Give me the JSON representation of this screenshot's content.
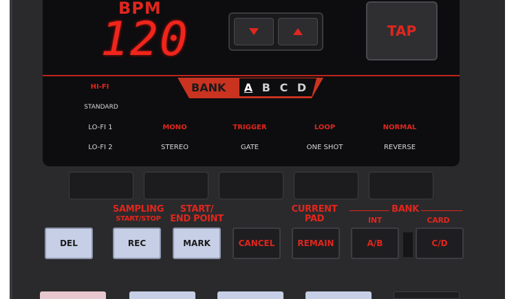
{
  "display": {
    "bpm_label": "BPM",
    "bpm_value": "120",
    "tap_label": "TAP",
    "bank": {
      "label": "BANK",
      "letters": [
        "A",
        "B",
        "C",
        "D"
      ],
      "selected": "A"
    },
    "modes": {
      "hifi": "HI-FI",
      "standard": "STANDARD",
      "lofi1": "LO-FI 1",
      "lofi2": "LO-FI 2",
      "mono": "MONO",
      "stereo": "STEREO",
      "trigger": "TRIGGER",
      "gate": "GATE",
      "loop": "LOOP",
      "one_shot": "ONE SHOT",
      "normal": "NORMAL",
      "reverse": "REVERSE"
    }
  },
  "functions": {
    "sampling_line1": "SAMPLING",
    "sampling_line2": "START/STOP",
    "start_end_line1": "START/",
    "start_end_line2": "END POINT",
    "current_pad_line1": "CURRENT",
    "current_pad_line2": "PAD",
    "bank": "BANK",
    "int": "INT",
    "card": "CARD"
  },
  "buttons": {
    "del": "DEL",
    "rec": "REC",
    "mark": "MARK",
    "cancel": "CANCEL",
    "remain": "REMAIN",
    "ab": "A/B",
    "cd": "C/D"
  },
  "colors": {
    "accent_red": "#e0261d",
    "body": "#2a2a2c",
    "display": "#0d0d0f",
    "light_key": "#c6cfe6"
  }
}
